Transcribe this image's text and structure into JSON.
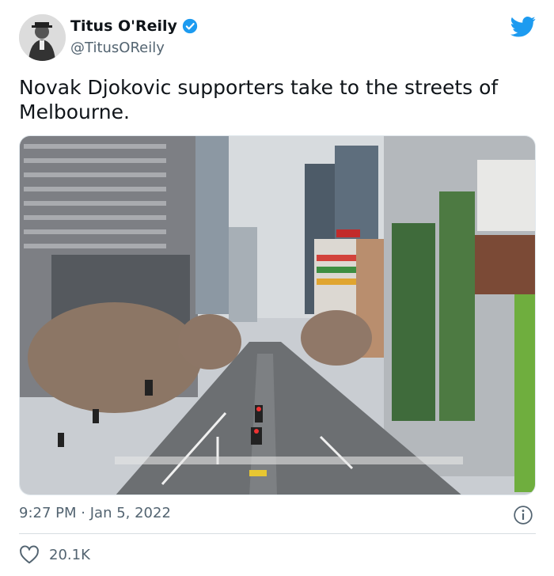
{
  "author": {
    "display_name": "Titus O'Reily",
    "handle": "@TitusOReily",
    "verified": true
  },
  "tweet": {
    "text": "Novak Djokovic supporters take to the streets of Melbourne.",
    "time": "9:27 PM",
    "separator": "·",
    "date": "Jan 5, 2022",
    "likes": "20.1K"
  },
  "colors": {
    "brand_blue": "#1d9bf0",
    "text_primary": "#0f1419",
    "text_secondary": "#536471"
  },
  "icons": {
    "logo": "twitter-bird-icon",
    "verified": "verified-badge-icon",
    "info": "info-icon",
    "like": "heart-icon"
  }
}
